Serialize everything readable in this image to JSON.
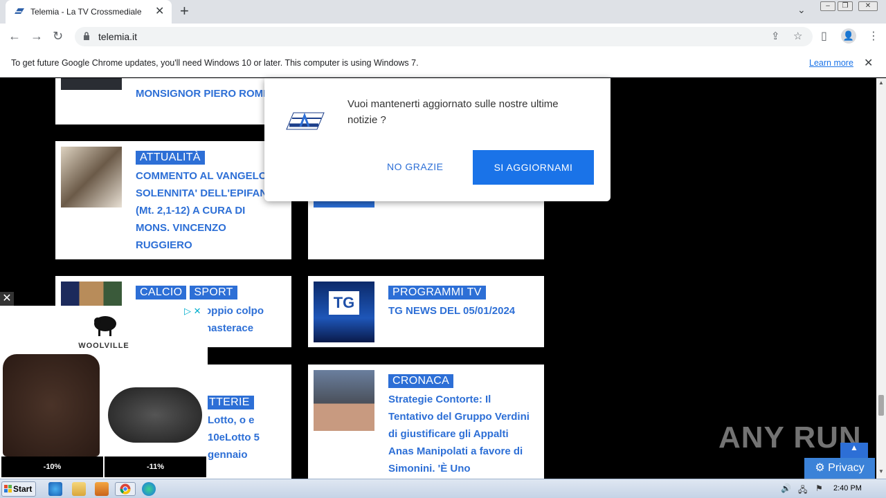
{
  "browser": {
    "tab_title": "Telemia - La TV Crossmediale",
    "url": "telemia.it",
    "infobar_message": "To get future Google Chrome updates, you'll need Windows 10 or later. This computer is using Windows 7.",
    "infobar_link": "Learn more"
  },
  "cards": [
    {
      "title": "MONSIGNOR PIERO ROMEO",
      "tags": []
    },
    {
      "title": "COMMENTO AL VANGELO SOLENNITA' DELL'EPIFANIA (Mt. 2,1-12) A CURA DI MONS. VINCENZO RUGGIERO",
      "tags": [
        "ATTUALITÀ"
      ]
    },
    {
      "title": "oppio colpo nasterace",
      "tags": [
        "CALCIO",
        "SPORT"
      ]
    },
    {
      "title": "TG NEWS DEL 05/01/2024",
      "tags": [
        "PROGRAMMI TV"
      ]
    },
    {
      "title": "Lotto, o e 10eLotto 5 gennaio",
      "tags": [
        "TTERIE"
      ]
    },
    {
      "title": "Strategie Contorte: Il Tentativo del Gruppo Verdini di giustificare gli Appalti Anas Manipolati a favore di Simonini. 'È Uno",
      "tags": [
        "CRONACA"
      ]
    }
  ],
  "popup": {
    "message": "Vuoi mantenerti aggiornato sulle nostre ultime notizie ?",
    "no_label": "NO GRAZIE",
    "yes_label": "SI AGGIORNAMI"
  },
  "ad": {
    "brand": "WOOLVILLE",
    "discount_left": "-10%",
    "discount_right": "-11%"
  },
  "watermark": "ANY RUN",
  "privacy_label": "Privacy",
  "taskbar": {
    "start_label": "Start",
    "clock": "2:40 PM"
  },
  "colors": {
    "accent": "#2d6fd6",
    "chrome_blue": "#1a73e8"
  }
}
